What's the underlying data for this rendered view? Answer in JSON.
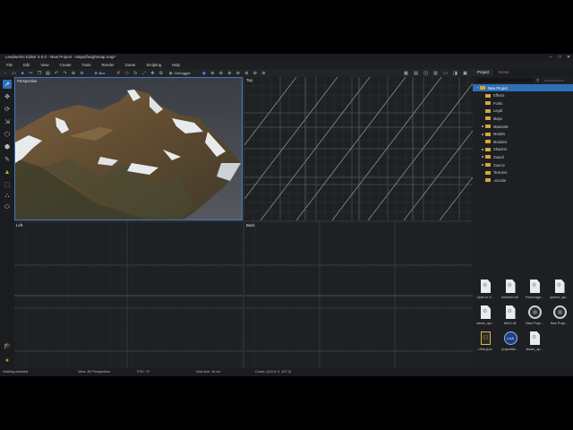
{
  "window": {
    "title": "Leadwerks Editor 5.0.0 - New Project - Maps/heightmap.map*",
    "minimize_glyph": "–",
    "maximize_glyph": "□",
    "close_glyph": "✕"
  },
  "menu": [
    "File",
    "Edit",
    "View",
    "Create",
    "Tools",
    "Render",
    "Game",
    "Scripting",
    "Help"
  ],
  "toolbar": {
    "select_label": "Box",
    "run_label": "Debugger",
    "icons": [
      "new-icon",
      "open-icon",
      "save-icon",
      "cut-icon",
      "copy-icon",
      "paste-icon",
      "undo-icon",
      "redo-icon",
      "zoom-in-icon",
      "zoom-out-icon",
      "grid-icon",
      "snap-icon",
      "rotate-icon",
      "scale-icon"
    ]
  },
  "left_tools": [
    "select-icon",
    "move-icon",
    "rotate-icon",
    "scale-icon",
    "vertex-icon",
    "face-icon",
    "terrain-icon",
    "paint-icon",
    "group-icon",
    "scene-icon",
    "cap-icon",
    "avatar-icon"
  ],
  "viewports": {
    "perspective": "Perspective",
    "top": "Top",
    "left": "Left",
    "back": "Back"
  },
  "right_panel": {
    "tabs": [
      "Project",
      "Scene"
    ],
    "tree": [
      {
        "label": "New Project",
        "level": 0,
        "expanded": true,
        "selected": true
      },
      {
        "label": "Effects",
        "level": 1,
        "expanded": false
      },
      {
        "label": "Fonts",
        "level": 1,
        "expanded": false
      },
      {
        "label": "Legal",
        "level": 1,
        "expanded": false
      },
      {
        "label": "Maps",
        "level": 1,
        "expanded": false
      },
      {
        "label": "Materials",
        "level": 1,
        "expanded": false,
        "has_children": true
      },
      {
        "label": "Models",
        "level": 1,
        "expanded": false,
        "has_children": true
      },
      {
        "label": "Modules",
        "level": 1,
        "expanded": false
      },
      {
        "label": "Shaders",
        "level": 1,
        "expanded": false,
        "has_children": true
      },
      {
        "label": "Sound",
        "level": 1,
        "expanded": false,
        "has_children": true
      },
      {
        "label": "Source",
        "level": 1,
        "expanded": false,
        "has_children": true
      },
      {
        "label": "Textures",
        "level": 1,
        "expanded": false
      },
      {
        "label": ".vscode",
        "level": 1,
        "expanded": false
      }
    ],
    "files": [
      {
        "name": "Open in V...",
        "kind": "doc"
      },
      {
        "name": "embree4.dll",
        "kind": "doc"
      },
      {
        "name": "FreeImage...",
        "kind": "doc"
      },
      {
        "name": "openvr_api...",
        "kind": "doc"
      },
      {
        "name": "steam_api...",
        "kind": "doc"
      },
      {
        "name": "tbb12.dll",
        "kind": "doc"
      },
      {
        "name": "New Proje...",
        "kind": "ring"
      },
      {
        "name": "New Proje...",
        "kind": "ring"
      },
      {
        "name": "Ultra.json",
        "kind": "json"
      },
      {
        "name": "projectfile...",
        "kind": "lua"
      },
      {
        "name": "steam_ap...",
        "kind": "doc"
      }
    ]
  },
  "status": {
    "selection": "Nothing selected",
    "view": "View: 3D Perspective",
    "fov": "FOV: 70",
    "grid": "Grid size: 16 cm",
    "coords": "Coord: (110.6, 0, 107.2)"
  },
  "colors": {
    "accent": "#2f6fb8",
    "folder": "#d9a53c",
    "run": "#59c25a"
  }
}
